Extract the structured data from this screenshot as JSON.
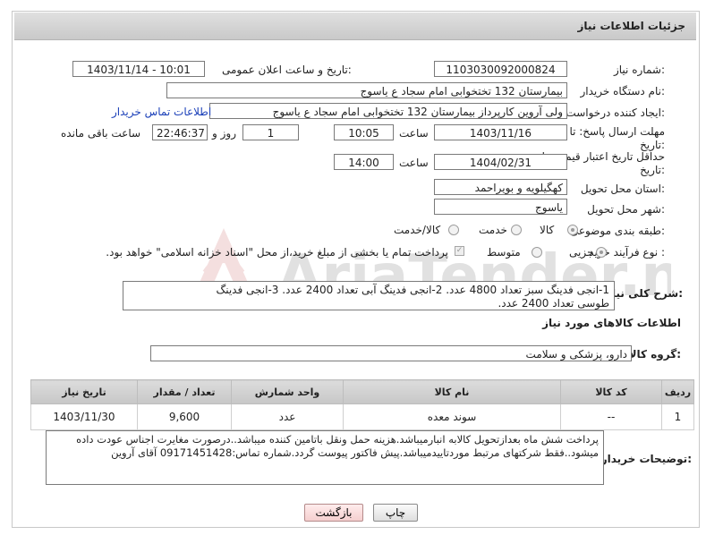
{
  "header": {
    "title": "جزئیات اطلاعات نیاز"
  },
  "fields": {
    "need_number_label": "شماره نیاز:",
    "need_number": "1103030092000824",
    "announce_label": "تاریخ و ساعت اعلان عمومی:",
    "announce_value": "1403/11/14 - 10:01",
    "buyer_org_label": "نام دستگاه خریدار:",
    "buyer_org": "بیمارستان 132 تختخوابی امام سجاد  ع  یاسوج",
    "creator_label": "ایجاد کننده درخواست:",
    "creator": "ولی آروین کارپرداز بیمارستان 132 تختخوابی امام سجاد  ع  یاسوج",
    "buyer_contact_link": "اطلاعات تماس خریدار",
    "deadline_label_1": "مهلت ارسال پاسخ: تا",
    "deadline_label_2": "تاریخ:",
    "deadline_date": "1403/11/16",
    "time_label": "ساعت",
    "deadline_time": "10:05",
    "days_value": "1",
    "days_and_label": "روز و",
    "remaining_time": "22:46:37",
    "remaining_label": "ساعت باقی مانده",
    "validity_label_1": "حداقل تاریخ اعتبار قیمت: تا",
    "validity_label_2": "تاریخ:",
    "validity_date": "1404/02/31",
    "validity_time": "14:00",
    "province_label": "استان محل تحویل:",
    "province": "کهگیلویه و بویراحمد",
    "city_label": "شهر محل تحویل:",
    "city": "یاسوج",
    "category_label": "طبقه بندی موضوعی:",
    "category_options": [
      "کالا",
      "خدمت",
      "کالا/خدمت"
    ],
    "process_label": "نوع فرآیند خرید :",
    "process_options": [
      "جزیی",
      "متوسط"
    ],
    "payment_note": "پرداخت تمام یا بخشی از مبلغ خرید،از محل \"اسناد خزانه اسلامی\" خواهد بود.",
    "description_label": "شرح کلی نیاز:",
    "description_line1": "1-انجی فدینگ سبز تعداد 4800 عدد.      2-انجی فدینگ آبی تعداد 2400 عدد.      3-انجی فدینگ",
    "description_line2": "طوسی تعداد 2400 عدد.",
    "goods_info_title": "اطلاعات کالاهای مورد نیاز",
    "goods_group_label": "گروه کالا:",
    "goods_group": "دارو، پزشکی و سلامت"
  },
  "table": {
    "headers": [
      "ردیف",
      "کد کالا",
      "نام کالا",
      "واحد شمارش",
      "تعداد / مقدار",
      "تاریخ نیاز"
    ],
    "rows": [
      [
        "1",
        "--",
        "سوند معده",
        "عدد",
        "9,600",
        "1403/11/30"
      ]
    ]
  },
  "buyer_notes_label": "توضیحات خریدار:",
  "buyer_notes_line1": "پرداخت شش ماه بعدازتحویل کالابه انبارمیباشد.هزینه حمل ونقل باتامین کننده میباشد..درصورت مغایرت اجناس عودت داده",
  "buyer_notes_line2": "میشود..فقط شرکتهای مرتبط موردتاییدمیباشد.پیش فاکتور پیوست گردد.شماره تماس:09171451428 آقای آروین",
  "buttons": {
    "print": "چاپ",
    "back": "بازگشت"
  },
  "watermark": {
    "text": "AriaTender.net"
  },
  "colors": {
    "link": "#1a3fb8",
    "header_bg": "#d2d2d2"
  }
}
